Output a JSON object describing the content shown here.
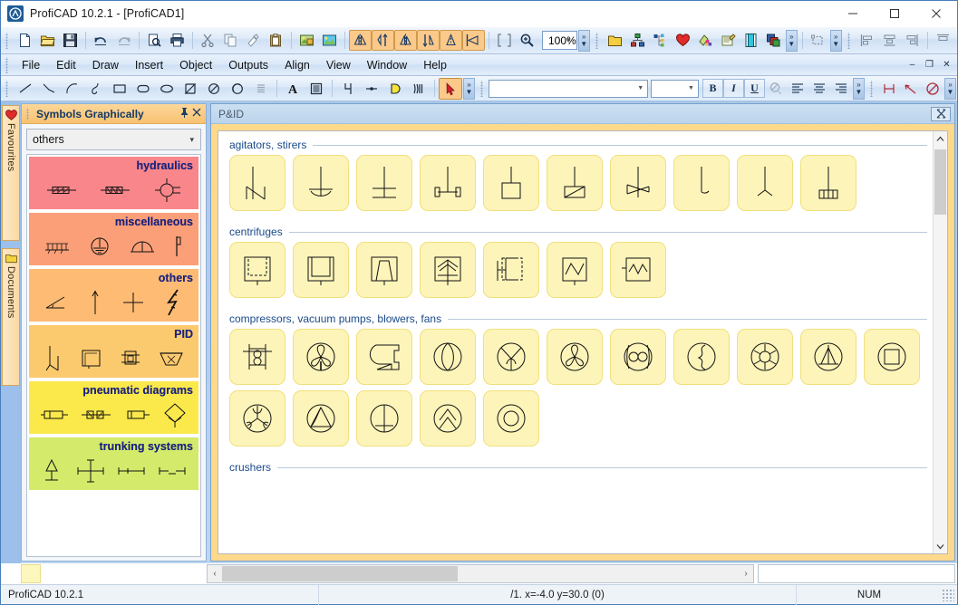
{
  "window": {
    "title": "ProfiCAD 10.2.1 - [ProfiCAD1]",
    "app_icon": "proficad-logo-icon",
    "minimize": "–",
    "maximize": "☐",
    "close": "✕"
  },
  "menubar": {
    "items": [
      {
        "label": "File"
      },
      {
        "label": "Edit"
      },
      {
        "label": "Draw"
      },
      {
        "label": "Insert"
      },
      {
        "label": "Object"
      },
      {
        "label": "Outputs"
      },
      {
        "label": "Align"
      },
      {
        "label": "View"
      },
      {
        "label": "Window"
      },
      {
        "label": "Help"
      }
    ],
    "doc_minimize": "–",
    "doc_restore": "❐",
    "doc_close": "✕"
  },
  "standard_toolbar": {
    "zoom_value": "100%",
    "buttons": [
      {
        "name": "new-document-icon",
        "title": "New"
      },
      {
        "name": "open-folder-icon",
        "title": "Open"
      },
      {
        "name": "save-disk-icon",
        "title": "Save"
      },
      {
        "name": "undo-icon",
        "title": "Undo"
      },
      {
        "name": "redo-icon",
        "title": "Redo"
      },
      {
        "name": "print-preview-icon",
        "title": "Print preview"
      },
      {
        "name": "print-icon",
        "title": "Print"
      },
      {
        "name": "cut-scissors-icon",
        "title": "Cut"
      },
      {
        "name": "copy-icon",
        "title": "Copy"
      },
      {
        "name": "format-painter-icon",
        "title": "Format painter"
      },
      {
        "name": "paste-icon",
        "title": "Paste"
      },
      {
        "name": "image-insert-icon",
        "title": "Insert picture"
      },
      {
        "name": "image-background-icon",
        "title": "Background picture"
      },
      {
        "name": "mirror-horizontal-icon",
        "title": "Mirror horizontally"
      },
      {
        "name": "rotate-up-icon",
        "title": "Rotate"
      },
      {
        "name": "mirror-icon",
        "title": "Mirror"
      },
      {
        "name": "flip-vertical-icon",
        "title": "Flip vertically"
      },
      {
        "name": "flip-icon",
        "title": "Flip"
      },
      {
        "name": "rotate-left-icon",
        "title": "Rotate left"
      },
      {
        "name": "fit-to-window-icon",
        "title": "Fit to window"
      },
      {
        "name": "zoom-in-icon",
        "title": "Zoom"
      }
    ]
  },
  "objects_toolbar": {
    "buttons": [
      {
        "name": "folder-yellow-icon"
      },
      {
        "name": "hierarchy-icon"
      },
      {
        "name": "structure-icon"
      },
      {
        "name": "favourites-heart-icon"
      },
      {
        "name": "colors-icon"
      },
      {
        "name": "notes-icon"
      },
      {
        "name": "film-strip-icon"
      },
      {
        "name": "layers-icon"
      }
    ]
  },
  "shape_toolbar": {
    "buttons": [
      {
        "name": "selection-rect-icon"
      }
    ]
  },
  "align_toolbar": {
    "buttons": [
      {
        "name": "align-left-icon"
      },
      {
        "name": "align-center-horizontal-icon"
      },
      {
        "name": "align-right-icon"
      },
      {
        "name": "align-top-icon"
      },
      {
        "name": "align-middle-icon"
      },
      {
        "name": "align-bottom-icon"
      }
    ]
  },
  "draw_toolbar": {
    "buttons": [
      {
        "name": "line-icon"
      },
      {
        "name": "polyline-icon"
      },
      {
        "name": "arc-icon"
      },
      {
        "name": "bezier-icon"
      },
      {
        "name": "rectangle-icon"
      },
      {
        "name": "rounded-rect-icon"
      },
      {
        "name": "ellipse-icon"
      },
      {
        "name": "hourglass-icon"
      },
      {
        "name": "circle-slash-icon"
      },
      {
        "name": "circle-arc-icon"
      },
      {
        "name": "hatch-icon"
      },
      {
        "name": "text-icon"
      },
      {
        "name": "text-block-icon"
      },
      {
        "name": "wire-icon"
      },
      {
        "name": "junction-icon"
      },
      {
        "name": "terminal-icon"
      },
      {
        "name": "bus-icon"
      },
      {
        "name": "cursor-arrow-icon"
      }
    ]
  },
  "format_toolbar": {
    "font_name": "",
    "font_size": "",
    "bold": "B",
    "italic": "I",
    "underline": "U",
    "buttons": [
      {
        "name": "font-color-icon"
      },
      {
        "name": "align-text-left-icon"
      },
      {
        "name": "align-text-center-icon"
      },
      {
        "name": "align-text-right-icon"
      },
      {
        "name": "dimension-icon"
      },
      {
        "name": "leader-line-icon"
      },
      {
        "name": "no-entry-icon"
      }
    ]
  },
  "side_tabs": [
    {
      "label": "Favourites",
      "icon": "heart-icon"
    },
    {
      "label": "Documents",
      "icon": "folder-icon"
    }
  ],
  "symbols_panel": {
    "title": "Symbols Graphically",
    "pin": "⚓",
    "close": "✕",
    "selected_group": "others",
    "dropdown_arrow": "⌄",
    "categories": [
      {
        "label": "hydraulics",
        "color": "#f9868a",
        "symbols": [
          "hyd-valve-1",
          "hyd-valve-2",
          "hyd-pump"
        ]
      },
      {
        "label": "miscellaneous",
        "color": "#fb9f78",
        "symbols": [
          "misc-rake",
          "misc-earth",
          "misc-dome",
          "misc-flag"
        ]
      },
      {
        "label": "others",
        "color": "#fdbb74",
        "symbols": [
          "angle",
          "arrow-up",
          "cross",
          "lightning"
        ]
      },
      {
        "label": "PID",
        "color": "#fcca6e",
        "symbols": [
          "pid-flow",
          "pid-box",
          "pid-unit",
          "pid-hopper"
        ]
      },
      {
        "label": "pneumatic diagrams",
        "color": "#fbe94b",
        "symbols": [
          "pneu-cyl-1",
          "pneu-cyl-2",
          "pneu-cyl-3",
          "pneu-valve"
        ]
      },
      {
        "label": "trunking systems",
        "color": "#d4ea6b",
        "symbols": [
          "trunk-1",
          "trunk-2",
          "trunk-3",
          "trunk-4"
        ]
      }
    ]
  },
  "document_window": {
    "title": "P&ID",
    "close": "⌧",
    "sections": [
      {
        "title": "agitators, stirers",
        "tiles": [
          "stirrer-zigzag",
          "stirrer-anchor-curve",
          "stirrer-cross-bar",
          "stirrer-paddle-pair",
          "stirrer-box",
          "stirrer-hatched",
          "stirrer-zigzag-blade",
          "stirrer-hook",
          "stirrer-j-hook",
          "stirrer-comb"
        ]
      },
      {
        "title": "centrifuges",
        "tiles": [
          "centrifuge-dashed-box",
          "centrifuge-double-box",
          "centrifuge-cone",
          "centrifuge-arrow",
          "centrifuge-split",
          "centrifuge-zigzag",
          "centrifuge-wave"
        ]
      },
      {
        "title": "compressors, vacuum pumps, blowers, fans",
        "tiles": [
          "compressor-frame",
          "fan-3blade-circle",
          "blower-scroll",
          "pump-circle",
          "pump-split-circle",
          "fan-3blade-alt",
          "vacuum-double-circle",
          "pump-s-curve",
          "rotary-star",
          "turbine-t",
          "box-in-circle",
          "fan-tri-blade",
          "pump-triangle",
          "pump-cross-circle",
          "pump-chevron",
          "pump-ring"
        ]
      },
      {
        "title": "crushers",
        "tiles": []
      }
    ],
    "vscroll": {
      "up": "⌃",
      "down": "⌄"
    },
    "hscroll": {
      "left": "‹",
      "right": "›"
    }
  },
  "statusbar": {
    "app_version": "ProfiCAD 10.2.1",
    "coordinates": "/1.  x=-4.0  y=30.0 (0)",
    "num_lock": "NUM"
  }
}
